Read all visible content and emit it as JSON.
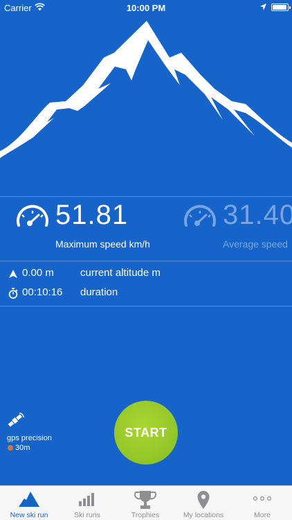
{
  "status_bar": {
    "carrier": "Carrier",
    "time": "10:00 PM"
  },
  "stats": {
    "max_speed": {
      "value": "51.81",
      "label": "Maximum speed km/h"
    },
    "avg_speed": {
      "value": "31.40",
      "label": "Average speed"
    },
    "altitude": {
      "value": "0.00 m",
      "label": "current altitude m"
    },
    "duration": {
      "value": "00:10:16",
      "label": "duration"
    }
  },
  "gps": {
    "label": "gps precision",
    "value": "30m",
    "status_color": "#c87a3e"
  },
  "start_button": {
    "label": "START"
  },
  "tab_bar": {
    "items": [
      {
        "label": "New ski run",
        "icon": "mountain-icon",
        "active": true
      },
      {
        "label": "Ski runs",
        "icon": "bar-chart-icon",
        "active": false
      },
      {
        "label": "Trophies",
        "icon": "trophy-icon",
        "active": false
      },
      {
        "label": "My locations",
        "icon": "map-pin-icon",
        "active": false
      },
      {
        "label": "More",
        "icon": "more-dots-icon",
        "active": false
      }
    ]
  },
  "colors": {
    "background": "#1664c9",
    "accent": "#1565c8",
    "start_green": "#95c82a",
    "tab_inactive": "#8e8e93"
  }
}
